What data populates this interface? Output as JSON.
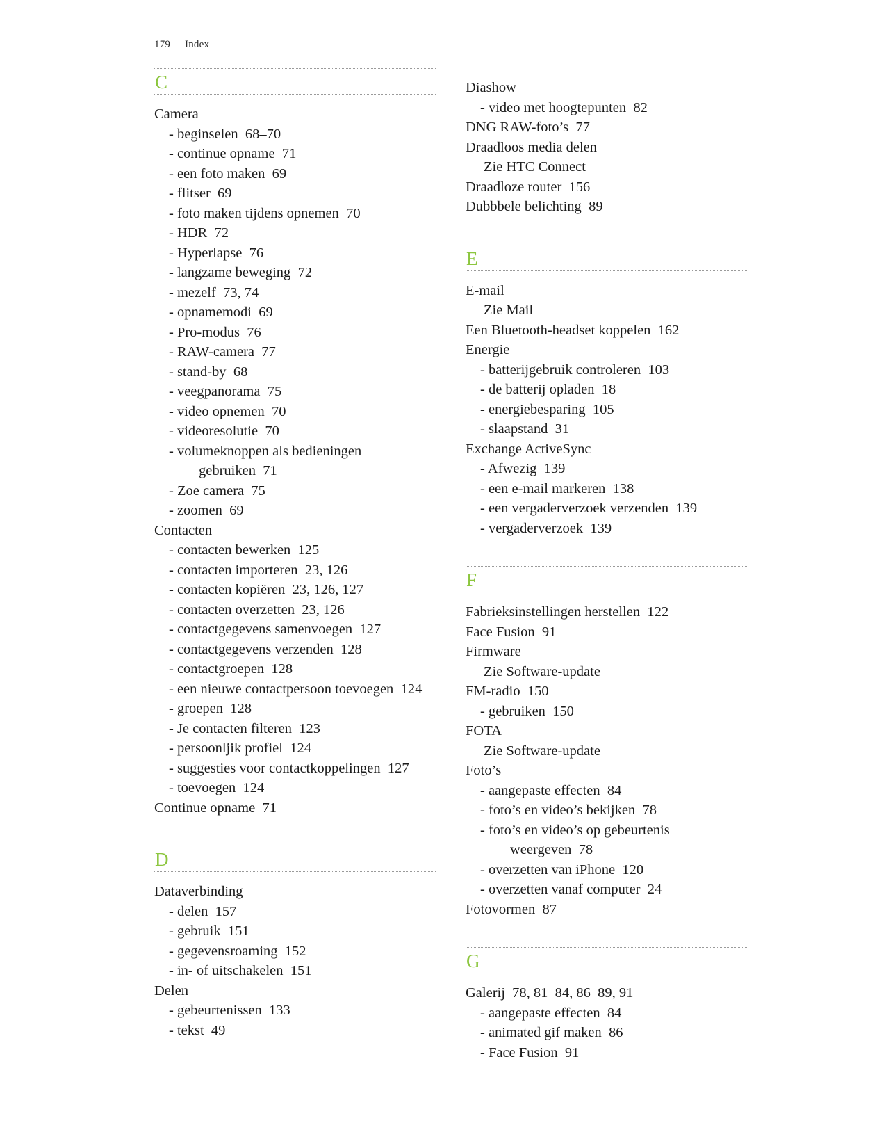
{
  "page": {
    "folio": "179",
    "section_title": "Index",
    "accent_color": "#8CC63E",
    "text_color": "#1c1c1c"
  },
  "columns": [
    {
      "name": "left-column",
      "sections": [
        {
          "letter": "C",
          "entries": [
            {
              "level": 0,
              "text": "Camera",
              "pages": ""
            },
            {
              "level": 1,
              "text": "- beginselen",
              "pages": "68–70"
            },
            {
              "level": 1,
              "text": "- continue opname",
              "pages": "71"
            },
            {
              "level": 1,
              "text": "- een foto maken",
              "pages": "69"
            },
            {
              "level": 1,
              "text": "- flitser",
              "pages": "69"
            },
            {
              "level": 1,
              "text": "- foto maken tijdens opnemen",
              "pages": "70"
            },
            {
              "level": 1,
              "text": "- HDR",
              "pages": "72"
            },
            {
              "level": 1,
              "text": "- Hyperlapse",
              "pages": "76"
            },
            {
              "level": 1,
              "text": "- langzame beweging",
              "pages": "72"
            },
            {
              "level": 1,
              "text": "- mezelf",
              "pages": "73, 74"
            },
            {
              "level": 1,
              "text": "- opnamemodi",
              "pages": "69"
            },
            {
              "level": 1,
              "text": "- Pro-modus",
              "pages": "76"
            },
            {
              "level": 1,
              "text": "- RAW-camera",
              "pages": "77"
            },
            {
              "level": 1,
              "text": "- stand-by",
              "pages": "68"
            },
            {
              "level": 1,
              "text": "- veegpanorama",
              "pages": "75"
            },
            {
              "level": 1,
              "text": "- video opnemen",
              "pages": "70"
            },
            {
              "level": 1,
              "text": "- videoresolutie",
              "pages": "70"
            },
            {
              "level": 1,
              "text": "- volumeknoppen als bedieningen",
              "pages": ""
            },
            {
              "level": 2,
              "text": "gebruiken",
              "pages": "71"
            },
            {
              "level": 1,
              "text": "- Zoe camera",
              "pages": "75"
            },
            {
              "level": 1,
              "text": "- zoomen",
              "pages": "69"
            },
            {
              "level": 0,
              "text": "Contacten",
              "pages": ""
            },
            {
              "level": 1,
              "text": "- contacten bewerken",
              "pages": "125"
            },
            {
              "level": 1,
              "text": "- contacten importeren",
              "pages": "23, 126"
            },
            {
              "level": 1,
              "text": "- contacten kopiëren",
              "pages": "23, 126, 127"
            },
            {
              "level": 1,
              "text": "- contacten overzetten",
              "pages": "23, 126"
            },
            {
              "level": 1,
              "text": "- contactgegevens samenvoegen",
              "pages": "127"
            },
            {
              "level": 1,
              "text": "- contactgegevens verzenden",
              "pages": "128"
            },
            {
              "level": 1,
              "text": "- contactgroepen",
              "pages": "128"
            },
            {
              "level": 1,
              "text": "- een nieuwe contactpersoon toevoegen",
              "pages": "124"
            },
            {
              "level": 1,
              "text": "- groepen",
              "pages": "128"
            },
            {
              "level": 1,
              "text": "- Je contacten filteren",
              "pages": "123"
            },
            {
              "level": 1,
              "text": "- persoonljik profiel",
              "pages": "124"
            },
            {
              "level": 1,
              "text": "- suggesties voor contactkoppelingen",
              "pages": "127"
            },
            {
              "level": 1,
              "text": "- toevoegen",
              "pages": "124"
            },
            {
              "level": 0,
              "text": "Continue opname",
              "pages": "71"
            }
          ]
        },
        {
          "letter": "D",
          "entries": [
            {
              "level": 0,
              "text": "Dataverbinding",
              "pages": ""
            },
            {
              "level": 1,
              "text": "- delen",
              "pages": "157"
            },
            {
              "level": 1,
              "text": "- gebruik",
              "pages": "151"
            },
            {
              "level": 1,
              "text": "- gegevensroaming",
              "pages": "152"
            },
            {
              "level": 1,
              "text": "- in- of uitschakelen",
              "pages": "151"
            },
            {
              "level": 0,
              "text": "Delen",
              "pages": ""
            },
            {
              "level": 1,
              "text": "- gebeurtenissen",
              "pages": "133"
            },
            {
              "level": 1,
              "text": "- tekst",
              "pages": "49"
            }
          ]
        }
      ]
    },
    {
      "name": "right-column",
      "sections": [
        {
          "letter": "",
          "entries": [
            {
              "level": 0,
              "text": "Diashow",
              "pages": ""
            },
            {
              "level": 1,
              "text": "- video met hoogtepunten",
              "pages": "82"
            },
            {
              "level": 0,
              "text": "DNG RAW-foto’s",
              "pages": "77"
            },
            {
              "level": 0,
              "text": "Draadloos media delen",
              "pages": ""
            },
            {
              "level": 3,
              "text": "Zie HTC Connect",
              "pages": ""
            },
            {
              "level": 0,
              "text": "Draadloze router",
              "pages": "156"
            },
            {
              "level": 0,
              "text": "Dubbbele belichting",
              "pages": "89"
            }
          ]
        },
        {
          "letter": "E",
          "entries": [
            {
              "level": 0,
              "text": "E-mail",
              "pages": ""
            },
            {
              "level": 3,
              "text": "Zie Mail",
              "pages": ""
            },
            {
              "level": 0,
              "text": "Een Bluetooth-headset koppelen",
              "pages": "162"
            },
            {
              "level": 0,
              "text": "Energie",
              "pages": ""
            },
            {
              "level": 1,
              "text": "- batterijgebruik controleren",
              "pages": "103"
            },
            {
              "level": 1,
              "text": "- de batterij opladen",
              "pages": "18"
            },
            {
              "level": 1,
              "text": "- energiebesparing",
              "pages": "105"
            },
            {
              "level": 1,
              "text": "- slaapstand",
              "pages": "31"
            },
            {
              "level": 0,
              "text": "Exchange ActiveSync",
              "pages": ""
            },
            {
              "level": 1,
              "text": "- Afwezig",
              "pages": "139"
            },
            {
              "level": 1,
              "text": "- een e-mail markeren",
              "pages": "138"
            },
            {
              "level": 1,
              "text": "- een vergaderverzoek verzenden",
              "pages": "139"
            },
            {
              "level": 1,
              "text": "- vergaderverzoek",
              "pages": "139"
            }
          ]
        },
        {
          "letter": "F",
          "entries": [
            {
              "level": 0,
              "text": "Fabrieksinstellingen herstellen",
              "pages": "122"
            },
            {
              "level": 0,
              "text": "Face Fusion",
              "pages": "91"
            },
            {
              "level": 0,
              "text": "Firmware",
              "pages": ""
            },
            {
              "level": 3,
              "text": "Zie Software-update",
              "pages": ""
            },
            {
              "level": 0,
              "text": "FM-radio",
              "pages": "150"
            },
            {
              "level": 1,
              "text": "- gebruiken",
              "pages": "150"
            },
            {
              "level": 0,
              "text": "FOTA",
              "pages": ""
            },
            {
              "level": 3,
              "text": "Zie Software-update",
              "pages": ""
            },
            {
              "level": 0,
              "text": "Foto’s",
              "pages": ""
            },
            {
              "level": 1,
              "text": "- aangepaste effecten",
              "pages": "84"
            },
            {
              "level": 1,
              "text": "- foto’s en video’s bekijken",
              "pages": "78"
            },
            {
              "level": 1,
              "text": "- foto’s en video’s op gebeurtenis",
              "pages": ""
            },
            {
              "level": 2,
              "text": "weergeven",
              "pages": "78"
            },
            {
              "level": 1,
              "text": "- overzetten van iPhone",
              "pages": "120"
            },
            {
              "level": 1,
              "text": "- overzetten vanaf computer",
              "pages": "24"
            },
            {
              "level": 0,
              "text": "Fotovormen",
              "pages": "87"
            }
          ]
        },
        {
          "letter": "G",
          "entries": [
            {
              "level": 0,
              "text": "Galerij",
              "pages": "78, 81–84, 86–89, 91"
            },
            {
              "level": 1,
              "text": "- aangepaste effecten",
              "pages": "84"
            },
            {
              "level": 1,
              "text": "- animated gif maken",
              "pages": "86"
            },
            {
              "level": 1,
              "text": "- Face Fusion",
              "pages": "91"
            }
          ]
        }
      ]
    }
  ]
}
